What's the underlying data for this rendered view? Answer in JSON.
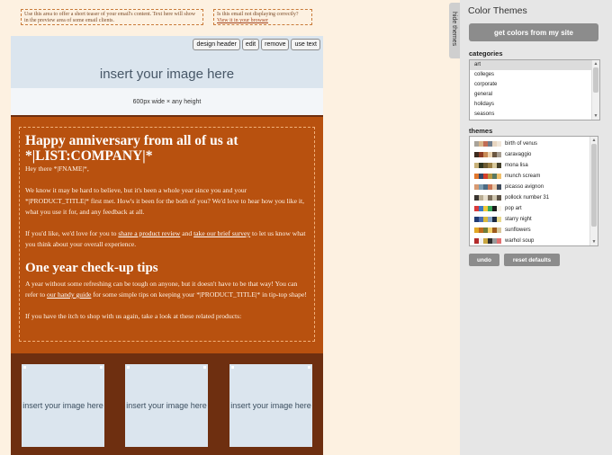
{
  "preheader": {
    "left_text": "Use this area to offer a short teaser of your email's content. Text here will show in the preview area of some email clients.",
    "right_text": "Is this email not displaying correctly?",
    "right_link": "View it in your browser"
  },
  "header": {
    "tools": [
      "design header",
      "edit",
      "remove",
      "use text"
    ],
    "image_placeholder": "insert your image here",
    "size_note": "600px wide × any height"
  },
  "content": {
    "heading1": "Happy anniversary from all of us at *|LIST:COMPANY|*",
    "greeting": "Hey there *|FNAME|*,",
    "para1": "We know it may be hard to believe, but it's been a whole year since you and your *|PRODUCT_TITLE|* first met. How's it been for the both of you? We'd love to hear how you like it, what you use it for, and any feedback at all.",
    "para2_pre": "If you'd like, we'd love for you to ",
    "para2_link1": "share a product review",
    "para2_mid": " and ",
    "para2_link2": "take our brief survey",
    "para2_post": " to let us know what you think about your overall experience.",
    "heading2": "One year check-up tips",
    "para3_pre": "A year without some refreshing can be tough on anyone, but it doesn't have to be that way! You can refer to ",
    "para3_link": "our handy guide",
    "para3_post": " for some simple tips on keeping your *|PRODUCT_TITLE|* in tip-top shape!",
    "para4": "If you have the itch to shop with us again, take a look at these related products:"
  },
  "products": [
    {
      "label": "insert your image here"
    },
    {
      "label": "insert your image here"
    },
    {
      "label": "insert your image here"
    }
  ],
  "panel": {
    "hide_tab": "hide themes",
    "title": "Color Themes",
    "get_colors_button": "get colors from my site",
    "categories_label": "categories",
    "categories": [
      "art",
      "colleges",
      "corporate",
      "general",
      "holidays",
      "seasons"
    ],
    "selected_category": "art",
    "themes_label": "themes",
    "themes": [
      {
        "name": "birth of venus",
        "colors": [
          "#a8a39a",
          "#d8b68b",
          "#c26d55",
          "#6f7c8c",
          "#e8d5c0",
          "#f1e6d9"
        ]
      },
      {
        "name": "caravaggio",
        "colors": [
          "#3b2a1e",
          "#8d3a22",
          "#c78a54",
          "#ead3b0",
          "#6b5641",
          "#a69c8f"
        ]
      },
      {
        "name": "mona lisa",
        "colors": [
          "#c9b27a",
          "#2f3621",
          "#6c5b33",
          "#9a7f44",
          "#d8c99c",
          "#44402b"
        ]
      },
      {
        "name": "munch scream",
        "colors": [
          "#e1782e",
          "#33486b",
          "#d5402b",
          "#b89740",
          "#5a7a63",
          "#f1c06c"
        ]
      },
      {
        "name": "picasso avignon",
        "colors": [
          "#d89a72",
          "#7f9db0",
          "#4c6b84",
          "#c97555",
          "#e9c8a9",
          "#3e4a5a"
        ]
      },
      {
        "name": "pollock number 31",
        "colors": [
          "#3a3530",
          "#b9ad94",
          "#e8e0cf",
          "#7c6f5c",
          "#cfc6b0",
          "#5a5044"
        ]
      },
      {
        "name": "pop art",
        "colors": [
          "#d93a3a",
          "#3b7bc4",
          "#f1c93a",
          "#3aa85a",
          "#1d1d1d",
          "#f7f2e6"
        ]
      },
      {
        "name": "starry night",
        "colors": [
          "#233b73",
          "#4a6db0",
          "#d9b83c",
          "#8aa8c9",
          "#1c2940",
          "#e9d98c"
        ]
      },
      {
        "name": "sunflowers",
        "colors": [
          "#e2a826",
          "#c0691e",
          "#6e7d3a",
          "#f3d06a",
          "#9c5a1c",
          "#d9c79a"
        ]
      },
      {
        "name": "warhol soup",
        "colors": [
          "#b32b2b",
          "#f1f1f1",
          "#c9a640",
          "#2d2d2d",
          "#9a9a9a",
          "#e26f6f"
        ]
      }
    ],
    "undo_button": "undo",
    "reset_button": "reset defaults"
  }
}
